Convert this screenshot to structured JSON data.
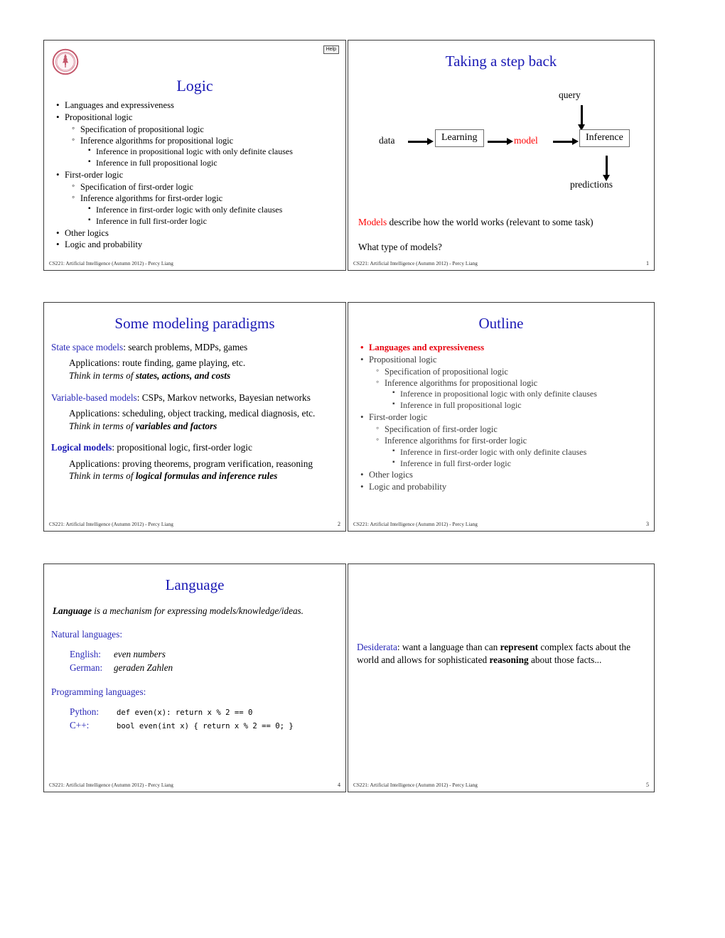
{
  "footer": {
    "text": "CS221: Artificial Intelligence (Autumn 2012) - Percy Liang"
  },
  "colors": {
    "title_blue": "#1a19b5",
    "accent_red": "#e8000d",
    "model_red": "#ff0000",
    "heading_blue": "#2a29b8",
    "seal_crimson": "#c4576b"
  },
  "slides": [
    {
      "id": "title-slide",
      "title": "Logic",
      "help_label": "Help",
      "page": "",
      "outline": [
        {
          "level": 1,
          "text": "Languages and expressiveness",
          "style": "normal"
        },
        {
          "level": 1,
          "text": "Propositional logic",
          "style": "normal"
        },
        {
          "level": 2,
          "text": "Specification of propositional logic",
          "style": "normal"
        },
        {
          "level": 2,
          "text": "Inference algorithms for propositional logic",
          "style": "normal"
        },
        {
          "level": 3,
          "text": "Inference in propositional logic with only definite clauses",
          "style": "normal"
        },
        {
          "level": 3,
          "text": "Inference in full propositional logic",
          "style": "normal"
        },
        {
          "level": 1,
          "text": "First-order logic",
          "style": "normal"
        },
        {
          "level": 2,
          "text": "Specification of first-order logic",
          "style": "normal"
        },
        {
          "level": 2,
          "text": "Inference algorithms for first-order logic",
          "style": "normal"
        },
        {
          "level": 3,
          "text": "Inference in first-order logic with only definite clauses",
          "style": "normal"
        },
        {
          "level": 3,
          "text": "Inference in full first-order logic",
          "style": "normal"
        },
        {
          "level": 1,
          "text": "Other logics",
          "style": "normal"
        },
        {
          "level": 1,
          "text": "Logic and probability",
          "style": "normal"
        }
      ]
    },
    {
      "id": "step-back-slide",
      "title": "Taking a step back",
      "page": "1",
      "diagram": {
        "data_label": "data",
        "learning_label": "Learning",
        "model_label": "model",
        "inference_label": "Inference",
        "query_label": "query",
        "predictions_label": "predictions"
      },
      "line1_key": "Models",
      "line1_rest": " describe how the world works (relevant to some task)",
      "line2": "What type of models?"
    },
    {
      "id": "paradigms-slide",
      "title": "Some modeling paradigms",
      "page": "2",
      "paradigms": [
        {
          "name": "State space models",
          "rest": ": search problems, MDPs, games",
          "bold": false,
          "applications": "Applications: route finding, game playing, etc.",
          "think_prefix": "Think in terms of ",
          "think_bold": "states, actions, and costs"
        },
        {
          "name": "Variable-based models",
          "rest": ": CSPs, Markov networks, Bayesian networks",
          "bold": false,
          "applications": "Applications: scheduling, object tracking, medical diagnosis, etc.",
          "think_prefix": "Think in terms of ",
          "think_bold": "variables and factors"
        },
        {
          "name": "Logical models",
          "rest": ": propositional logic, first-order logic",
          "bold": true,
          "applications": "Applications: proving theorems, program verification, reasoning",
          "think_prefix": "Think in terms of ",
          "think_bold": "logical formulas and inference rules"
        }
      ]
    },
    {
      "id": "outline-slide",
      "title": "Outline",
      "page": "3",
      "outline": [
        {
          "level": 1,
          "text": "Languages and expressiveness",
          "style": "highlight"
        },
        {
          "level": 1,
          "text": "Propositional logic",
          "style": "dim"
        },
        {
          "level": 2,
          "text": "Specification of propositional logic",
          "style": "dim"
        },
        {
          "level": 2,
          "text": "Inference algorithms for propositional logic",
          "style": "dim"
        },
        {
          "level": 3,
          "text": "Inference in propositional logic with only definite clauses",
          "style": "dim"
        },
        {
          "level": 3,
          "text": "Inference in full propositional logic",
          "style": "dim"
        },
        {
          "level": 1,
          "text": "First-order logic",
          "style": "dim"
        },
        {
          "level": 2,
          "text": "Specification of first-order logic",
          "style": "dim"
        },
        {
          "level": 2,
          "text": "Inference algorithms for first-order logic",
          "style": "dim"
        },
        {
          "level": 3,
          "text": "Inference in first-order logic with only definite clauses",
          "style": "dim"
        },
        {
          "level": 3,
          "text": "Inference in full first-order logic",
          "style": "dim"
        },
        {
          "level": 1,
          "text": "Other logics",
          "style": "dim"
        },
        {
          "level": 1,
          "text": "Logic and probability",
          "style": "dim"
        }
      ]
    },
    {
      "id": "language-slide",
      "title": "Language",
      "page": "4",
      "definition_bold": "Language",
      "definition_rest": " is a mechanism for expressing models/knowledge/ideas.",
      "natural_heading": "Natural languages:",
      "natural_rows": [
        {
          "name": "English:",
          "value": "even numbers"
        },
        {
          "name": "German:",
          "value": "geraden Zahlen"
        }
      ],
      "programming_heading": "Programming languages:",
      "programming_rows": [
        {
          "name": "Python:",
          "value": "def even(x): return x % 2 == 0"
        },
        {
          "name": "C++:",
          "value": "bool even(int x) { return x % 2 == 0; }"
        }
      ]
    },
    {
      "id": "desiderata-slide",
      "title": "",
      "page": "5",
      "desiderata_key": "Desiderata",
      "desiderata_p1": ": want a language than can ",
      "desiderata_b1": "represent",
      "desiderata_p2": " complex facts about the world and allows for sophisticated ",
      "desiderata_b2": "reasoning",
      "desiderata_p3": " about those facts..."
    }
  ]
}
